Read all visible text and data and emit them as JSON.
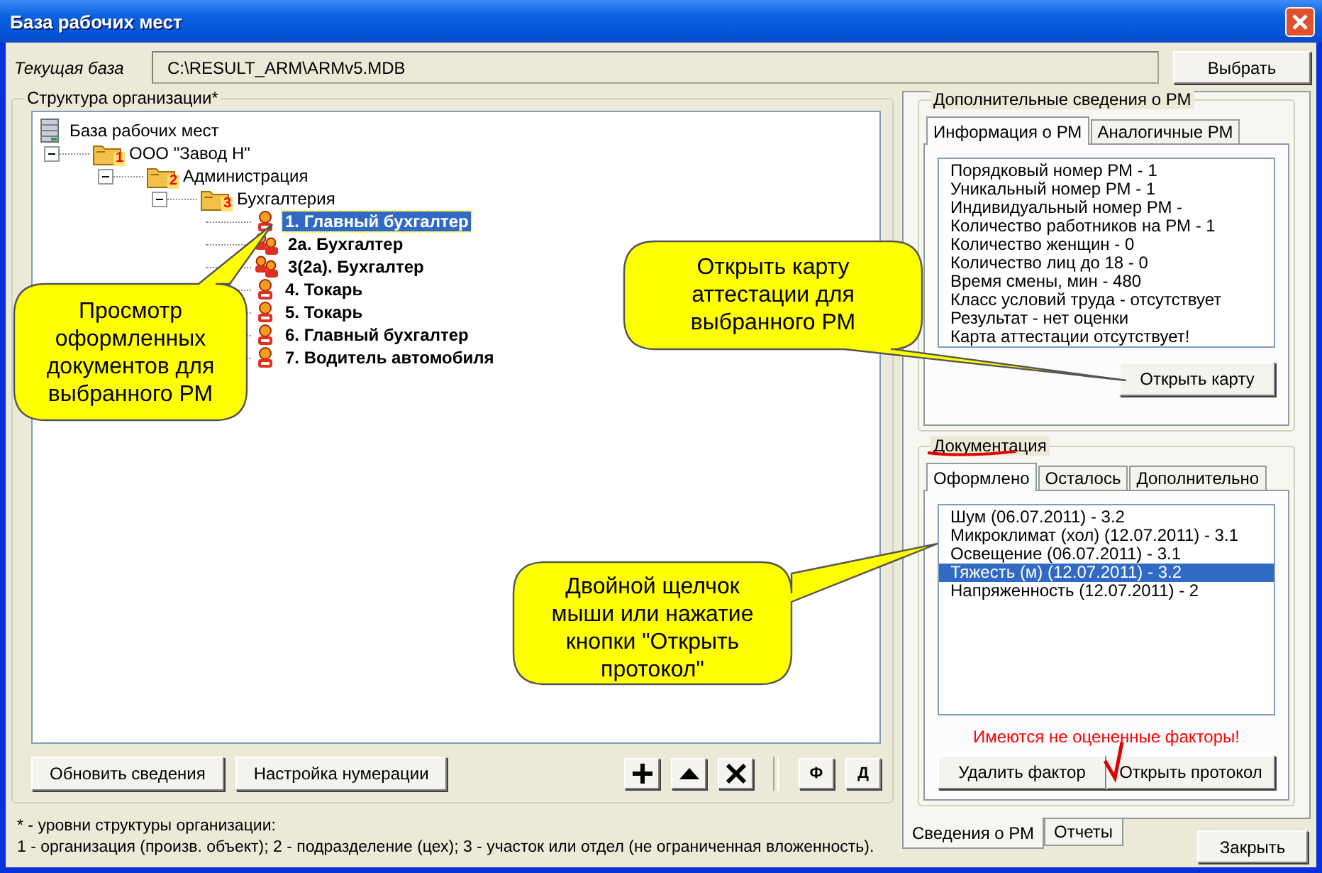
{
  "window": {
    "title": "База рабочих мест"
  },
  "current_base": {
    "label": "Текущая база",
    "value": "C:\\RESULT_ARM\\ARMv5.MDB",
    "button": "Выбрать"
  },
  "structure": {
    "title": "Структура организации*",
    "tree": [
      {
        "label": "База рабочих мест",
        "kind": "database",
        "selected": false,
        "children": [
          {
            "label": "ООО \"Завод Н\"",
            "kind": "folder",
            "badge": "1",
            "expanded": true,
            "selected": false,
            "children": [
              {
                "label": "Администрация",
                "kind": "folder",
                "badge": "2",
                "expanded": true,
                "selected": false,
                "children": [
                  {
                    "label": "Бухгалтерия",
                    "kind": "folder",
                    "badge": "3",
                    "expanded": true,
                    "selected": false,
                    "children": [
                      {
                        "label": "1. Главный бухгалтер",
                        "kind": "workplace",
                        "selected": true
                      },
                      {
                        "label": "2а. Бухгалтер",
                        "kind": "group",
                        "selected": false
                      },
                      {
                        "label": "3(2а). Бухгалтер",
                        "kind": "group",
                        "selected": false
                      },
                      {
                        "label": "4. Токарь",
                        "kind": "workplace",
                        "selected": false
                      },
                      {
                        "label": "5. Токарь",
                        "kind": "workplace",
                        "selected": false
                      },
                      {
                        "label": "6. Главный бухгалтер",
                        "kind": "workplace",
                        "selected": false
                      },
                      {
                        "label": "7. Водитель автомобиля",
                        "kind": "workplace",
                        "selected": false
                      }
                    ]
                  }
                ]
              }
            ]
          }
        ]
      }
    ],
    "buttons": [
      "Обновить сведения",
      "Настройка нумерации"
    ],
    "tools": [
      {
        "kind": "add"
      },
      {
        "kind": "up"
      },
      {
        "kind": "delete"
      },
      {
        "kind": "text",
        "label": "Ф"
      },
      {
        "kind": "text",
        "label": "Д"
      }
    ]
  },
  "footnote": [
    "* - уровни структуры организации:",
    "1 - организация (произв. объект); 2 - подразделение (цех); 3 - участок или отдел (не ограниченная вложенность)."
  ],
  "info": {
    "title": "Дополнительные сведения о РМ",
    "tabs": [
      {
        "label": "Информация о РМ",
        "selected": true
      },
      {
        "label": "Аналогичные РМ",
        "selected": false
      }
    ],
    "lines": [
      "Порядковый номер РМ - 1",
      "Уникальный номер РМ - 1",
      "Индивидуальный номер РМ -",
      "Количество работников на РМ - 1",
      "Количество женщин - 0",
      "Количество лиц до 18 - 0",
      "Время смены, мин - 480",
      "Класс условий труда - отсутствует",
      "Результат - нет оценки",
      "Карта аттестации отсутствует!"
    ],
    "button": "Открыть карту"
  },
  "docs": {
    "title": "Документация",
    "tabs": [
      {
        "label": "Оформлено",
        "selected": true
      },
      {
        "label": "Осталось",
        "selected": false
      },
      {
        "label": "Дополнительно",
        "selected": false
      }
    ],
    "items": [
      {
        "label": "Шум (06.07.2011) - 3.2",
        "selected": false
      },
      {
        "label": "Микроклимат (хол) (12.07.2011) - 3.1",
        "selected": false
      },
      {
        "label": "Освещение (06.07.2011) - 3.1",
        "selected": false
      },
      {
        "label": "Тяжесть (м) (12.07.2011) - 3.2",
        "selected": true
      },
      {
        "label": "Напряженность (12.07.2011) - 2",
        "selected": false
      }
    ],
    "warning": "Имеются не оцененные факторы!",
    "buttons": [
      "Удалить фактор",
      "Открыть протокол"
    ]
  },
  "bottom_tabs": [
    {
      "label": "Сведения о РМ",
      "selected": true
    },
    {
      "label": "Отчеты",
      "selected": false
    }
  ],
  "close_button": "Закрыть",
  "callouts": [
    {
      "lines": [
        "Просмотр",
        "оформленных",
        "документов для",
        "выбранного РМ"
      ]
    },
    {
      "lines": [
        "Открыть карту",
        "аттестации для",
        "выбранного РМ"
      ]
    },
    {
      "lines": [
        "Двойной щелчок",
        "мыши или нажатие",
        "кнопки \"Открыть",
        "протокол\""
      ]
    }
  ]
}
